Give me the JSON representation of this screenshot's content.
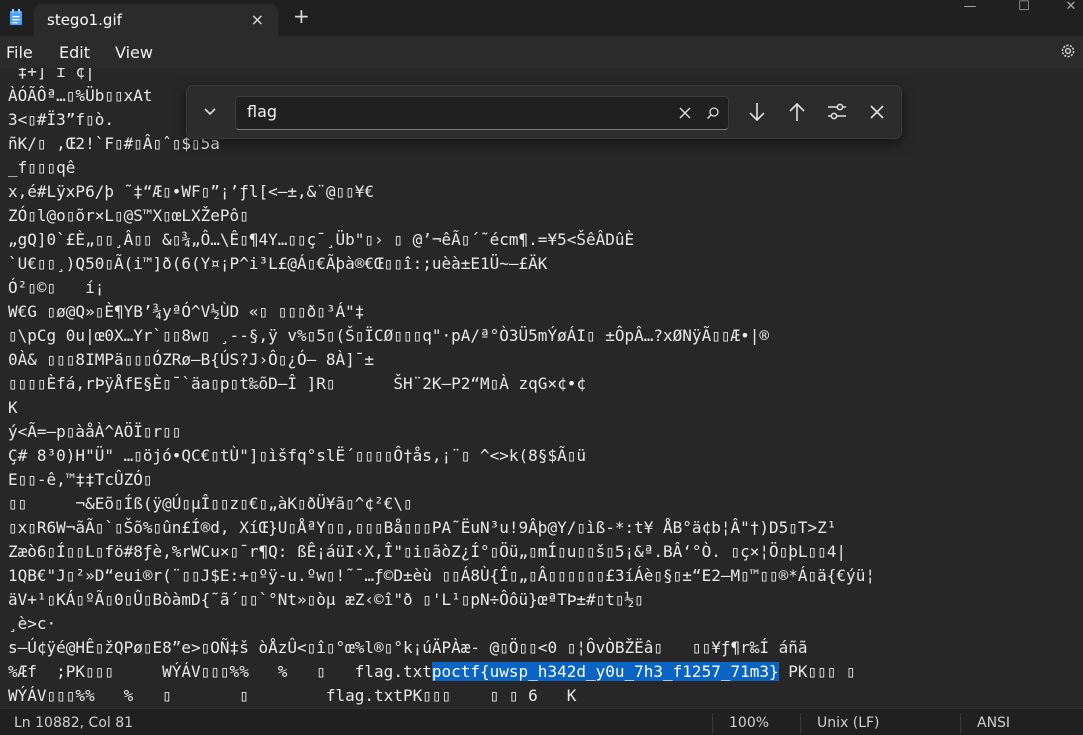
{
  "tab": {
    "title": "stego1.gif",
    "close_icon": "×",
    "new_tab_icon": "+"
  },
  "window_controls": {
    "minimize": "—",
    "maximize": "☐",
    "close": "✕"
  },
  "menu": {
    "file": "File",
    "edit": "Edit",
    "view": "View"
  },
  "find": {
    "query": "flag"
  },
  "editor_lines": [
    " ‡+] ɪ ¢|",
    "ÀÓÃÔª…▯%Üb▯▯xAt",
    "3<▯#Ï3”f▯ò.",
    "ñK/▯ ,Œ2!`F▯#▯Â▯ˆ▯$▯5a",
    "_f▯▯▯qê",
    "x,é#LÿxP6/þ ˜‡“Æ▯•WF▯”¡’ƒl[<—±,&¨@▯▯¥€",
    "ZÓ▯l@o▯õr×L▯@S™X▯œLXŽePô▯",
    "„gQ]0`£È„▯▯¸Â▯▯ &▯¾„Ô…\\Ê▯¶4Y…▯▯ç¯¸Üb\"▯› ▯ @’¬êÃ▯´˜écm¶.=¥5<ŠêÂDûÈ",
    "`U€▯▯¸)Q50▯Ã(i™]ð(6(Y¤¡P^i³L£@Á▯€Ãþà®€Œ▯▯î:;uèà±E1Ü~–£ÄK",
    "Ó²▯©▯   í¡",
    "W€G ▯ø@Q»▯È¶YB’¾yªÓ^V½ÙD «▯ ▯▯▯ð▯³Á\"‡",
    "▯\\pCg 0u|œ0X…Yr`▯▯8w▯ ¸--§,ÿ v%▯5▯(Š▯ÏCØ▯▯▯q\"·pA/ª°Ò3Ü5mÝøÁI▯ ±ÔpÂ…?xØNÿÃ▯▯Æ•|®",
    "0À& ▯▯▯8IMPä▯▯▯ÓZRø—B{ÚS?J›Ô▯¿Ó– 8À]¯±",
    "▯▯▯▯Èfá,rÞÿÅfE§È▯¯`äa▯p▯t‰õD—Î ]R▯      ŠH¨2K—P2“M▯À zqG×¢•¢",
    "K",
    "ý<Ã=—p▯àåÀ^AÖÏ▯r▯▯",
    "Ç# 8³0)H\"Ü\" …▯öjó•QC€▯tÙ\"]▯ìšfq°slË´▯▯▯▯Ô†ås,¡¨▯ ^<>k(8§$Ã▯ü",
    "E▯▯-ê,™‡‡TcÛZÓ▯",
    "▯▯     ¬&Eõ▯Íß(ÿ@Ú▯µÎ▯▯z▯€▯„àK▯ðÜ¥ã▯^¢²€\\▯",
    "▯x▯R6W¬ãÃ▯`▯Šõ%▯ûn£Í®d, XíŒ}U▯ÅªY▯▯,▯▯▯Bå▯▯▯PA˜ËuN³u!9Âþ@Y/▯ìß-*:t¥ ÅB°ä¢b¦Â\"†)D5▯T>Z¹",
    "Zæò6▯Í▯▯L▯fö#8ƒè,%rWCu×▯¯r¶Q: ßÊ¡áüI‹X,Î\"▯i▯ãòZ¿Í°▯Öü„▯mÍ▯u▯▯š▯5¡&ª.BÂ‘°Ò. ▯ç×¦Ö▯þL▯▯4|",
    "1QB€\"J▯²»D“eui®r(¨▯▯J$E:+▯ºÿ-u.ºw▯!˜¯…ƒ©D±èù ▯▯Á8Ù{Î▯„▯Â▯▯▯▯▯▯£3íÁè▯§▯±“E2—M▯™▯▯®*Á▯ä{€ýü¦",
    "äV+¹▯KÁ▯ºÃ▯0▯Û▯BòàmD{˜ã´▯▯`°Nt»▯òµ æZ‹©î\"ð ▯'L¹▯pN÷Ôôü}œªTÞ±#▯t▯½▯",
    "¸è>c·",
    "s–Ú¢ÿé@HÊ▯žQPø▯E8”e>▯OÑ‡š òÅzÛ<▯î▯°œ%l®▯°k¡úÄPÀæ- @▯Ö▯▯<0 ▯¦ÔvÒBŽËâ▯   ▯▯¥ƒ¶r‰Í áñã"
  ],
  "line26": {
    "prefix": "%Æf  ;PK▯▯▯     WÝÁV▯▯▯%%   %   ▯   flag.txt",
    "selected": "poctf{uwsp_h342d_y0u_7h3_f1257_71m3}",
    "suffix": " PK▯▯▯ ▯"
  },
  "line27": "WÝÁV▯▯▯%%   %   ▯       ▯        flag.txtPK▯▯▯    ▯ ▯ 6   K",
  "status": {
    "position": "Ln 10882, Col 81",
    "zoom": "100%",
    "eol": "Unix (LF)",
    "encoding": "ANSI"
  },
  "icons": {
    "app": "notepad-icon",
    "gear": "gear-icon",
    "toggle": "chevron-down-icon",
    "clear": "clear-icon",
    "search": "search-icon",
    "next": "arrow-down-icon",
    "prev": "arrow-up-icon",
    "options": "options-icon",
    "close": "close-icon"
  },
  "colors": {
    "background": "#272727",
    "selection": "#0a64c4",
    "find_panel": "#2c2c2c"
  }
}
